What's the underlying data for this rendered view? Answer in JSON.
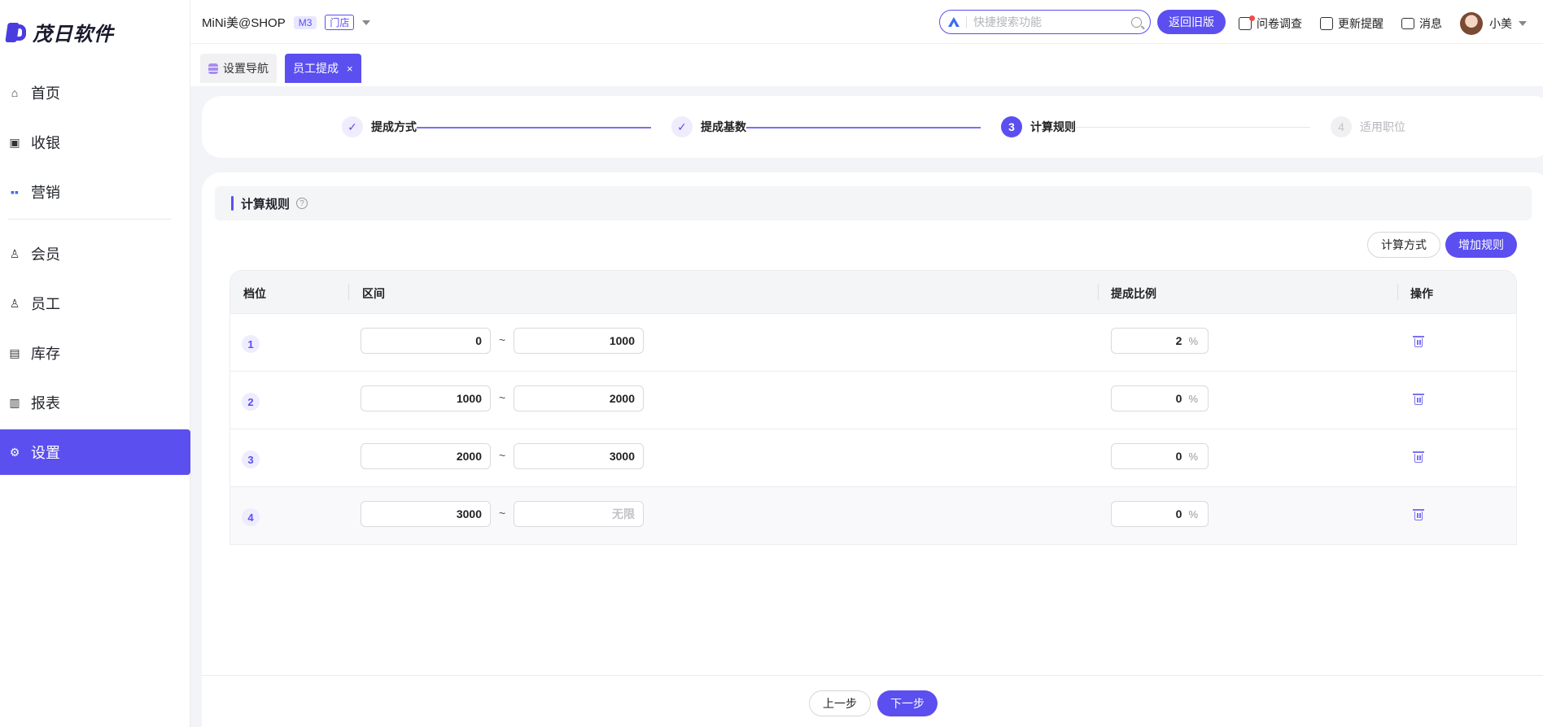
{
  "app": {
    "logo_text": "茂日软件"
  },
  "sidebar": {
    "items": [
      {
        "label": "首页",
        "icon": "home-icon"
      },
      {
        "label": "收银",
        "icon": "cashier-icon"
      },
      {
        "label": "营销",
        "icon": "marketing-icon"
      },
      {
        "label": "会员",
        "icon": "member-icon"
      },
      {
        "label": "员工",
        "icon": "staff-icon"
      },
      {
        "label": "库存",
        "icon": "inventory-icon"
      },
      {
        "label": "报表",
        "icon": "report-icon"
      },
      {
        "label": "设置",
        "icon": "settings-icon",
        "active": true
      }
    ]
  },
  "header": {
    "shop_name": "MiNi美@SHOP",
    "plan_badge": "M3",
    "store_badge": "门店",
    "search_placeholder": "快捷搜索功能",
    "old_version_label": "返回旧版",
    "survey_label": "问卷调查",
    "update_label": "更新提醒",
    "message_label": "消息",
    "user_name": "小美"
  },
  "tabs": [
    {
      "label": "设置导航"
    },
    {
      "label": "员工提成",
      "active": true,
      "close": "×"
    }
  ],
  "steps": [
    {
      "index": "1",
      "label": "提成方式",
      "status": "done"
    },
    {
      "index": "2",
      "label": "提成基数",
      "status": "done"
    },
    {
      "index": "3",
      "label": "计算规则",
      "status": "current"
    },
    {
      "index": "4",
      "label": "适用职位",
      "status": "todo"
    }
  ],
  "section": {
    "title": "计算规则",
    "help_icon": "?",
    "calc_method_label": "计算方式",
    "add_rule_label": "增加规则"
  },
  "table": {
    "headers": {
      "tier": "档位",
      "range": "区间",
      "ratio": "提成比例",
      "action": "操作"
    },
    "separator": "~",
    "unit": "%",
    "rows": [
      {
        "tier": "1",
        "from": "0",
        "to": "1000",
        "ratio": "2"
      },
      {
        "tier": "2",
        "from": "1000",
        "to": "2000",
        "ratio": "0"
      },
      {
        "tier": "3",
        "from": "2000",
        "to": "3000",
        "ratio": "0"
      },
      {
        "tier": "4",
        "from": "3000",
        "to": "",
        "to_placeholder": "无限",
        "ratio": "0"
      }
    ]
  },
  "footer": {
    "prev_label": "上一步",
    "next_label": "下一步"
  },
  "colors": {
    "primary": "#5b4ff0",
    "primary_light": "#eeecfd",
    "bg": "#f3f4f7"
  }
}
